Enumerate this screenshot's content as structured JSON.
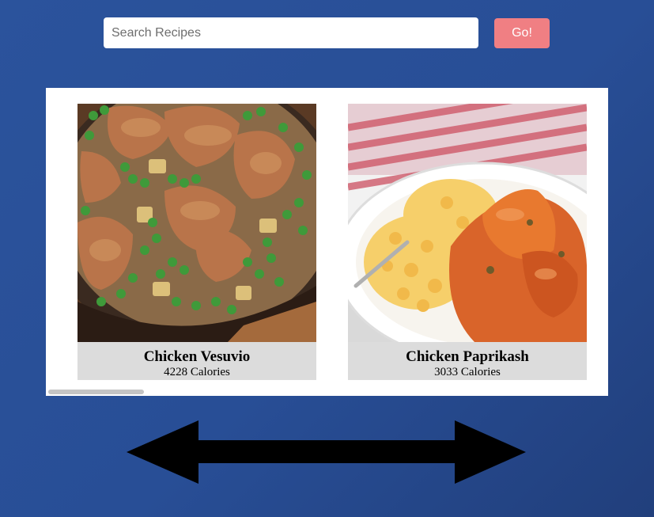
{
  "search": {
    "placeholder": "Search Recipes",
    "value": "",
    "button_label": "Go!"
  },
  "recipes": [
    {
      "name": "Chicken Vesuvio",
      "calories": "4228 Calories",
      "image": "chicken-vesuvio-photo"
    },
    {
      "name": "Chicken Paprikash",
      "calories": "3033 Calories",
      "image": "chicken-paprikash-photo"
    }
  ],
  "colors": {
    "background": "#2a519a",
    "button": "#f07f83",
    "card_caption": "#dcdcdc",
    "arrow": "#000000"
  },
  "icons": {
    "scroll_hint": "double-headed-arrow-icon"
  }
}
